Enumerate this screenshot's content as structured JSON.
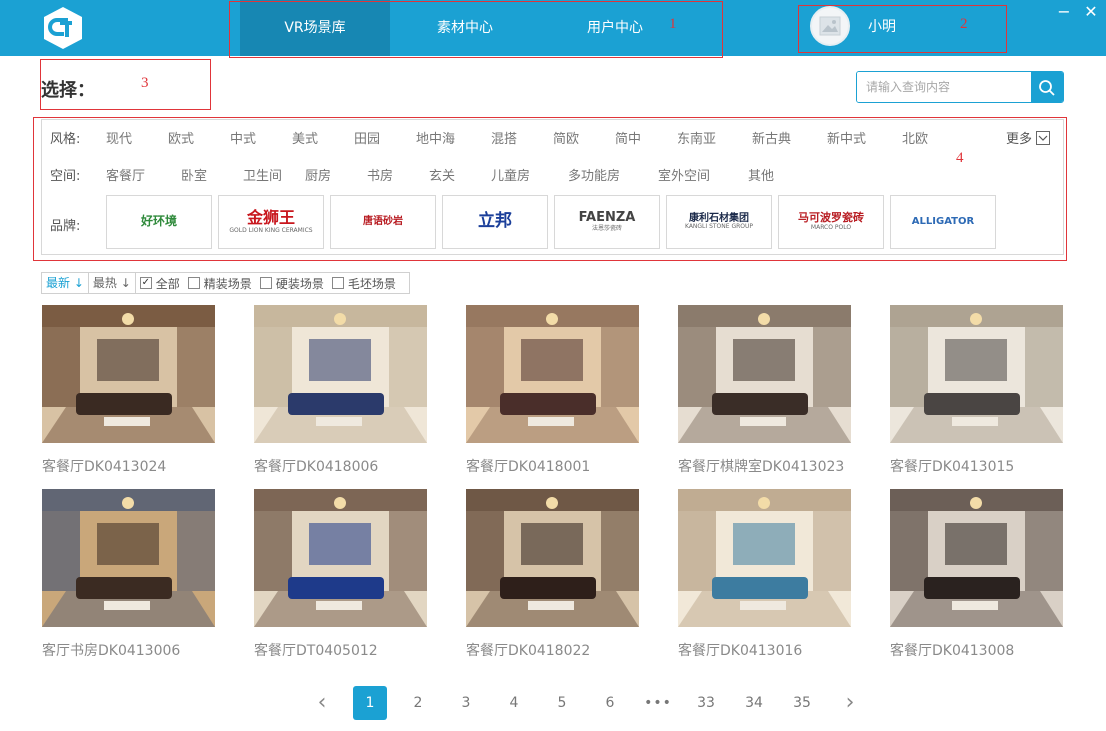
{
  "header": {
    "nav": [
      "VR场景库",
      "素材中心",
      "用户中心"
    ],
    "active_nav": 0,
    "user_name": "小明",
    "window_controls": {
      "minimize": "−",
      "close": "✕"
    }
  },
  "annotations": [
    "1",
    "2",
    "3",
    "4"
  ],
  "select_label": "选择：",
  "search": {
    "placeholder": "请输入查询内容"
  },
  "filters": {
    "style_label": "风格:",
    "styles": [
      "现代",
      "欧式",
      "中式",
      "美式",
      "田园",
      "地中海",
      "混搭",
      "简欧",
      "简中",
      "东南亚",
      "新古典",
      "新中式",
      "北欧"
    ],
    "more_label": "更多",
    "space_label": "空间:",
    "spaces": [
      "客餐厅",
      "卧室",
      "卫生间",
      "厨房",
      "书房",
      "玄关",
      "儿童房",
      "多功能房",
      "室外空间",
      "其他"
    ],
    "brand_label": "品牌:",
    "brands": [
      {
        "main": "好环境",
        "sub": ""
      },
      {
        "main": "金狮王",
        "sub": "GOLD LION KING CERAMICS"
      },
      {
        "main": "唐语砂岩",
        "sub": ""
      },
      {
        "main": "立邦",
        "sub": ""
      },
      {
        "main": "FAENZA",
        "sub": "法恩莎瓷砖"
      },
      {
        "main": "康利石材集团",
        "sub": "KANGLI STONE GROUP"
      },
      {
        "main": "马可波罗瓷砖",
        "sub": "MARCO POLO"
      },
      {
        "main": "ALLIGATOR",
        "sub": ""
      }
    ]
  },
  "sortbar": {
    "newest": "最新",
    "hottest": "最热",
    "checks": [
      {
        "label": "全部",
        "checked": true
      },
      {
        "label": "精装场景",
        "checked": false
      },
      {
        "label": "硬装场景",
        "checked": false
      },
      {
        "label": "毛坯场景",
        "checked": false
      }
    ]
  },
  "scenes": [
    {
      "title": "客餐厅DK0413024",
      "palette": [
        "#6b4a33",
        "#d8c2a4",
        "#3a2a22"
      ]
    },
    {
      "title": "客餐厅DK0418006",
      "palette": [
        "#bfae93",
        "#efe6d7",
        "#2b3a6b"
      ]
    },
    {
      "title": "客餐厅DK0418001",
      "palette": [
        "#8a6a54",
        "#e3c9a8",
        "#4a2e2a"
      ]
    },
    {
      "title": "客餐厅棋牌室DK0413023",
      "palette": [
        "#7a6a5a",
        "#e6ddd1",
        "#3a2d27"
      ]
    },
    {
      "title": "客餐厅DK0413015",
      "palette": [
        "#a39785",
        "#ece6dc",
        "#4a4543"
      ]
    },
    {
      "title": "客厅书房DK0413006",
      "palette": [
        "#4f5a73",
        "#c9a77a",
        "#3b2b22"
      ]
    },
    {
      "title": "客餐厅DT0405012",
      "palette": [
        "#6b5242",
        "#e2d6c2",
        "#1e3a8a"
      ]
    },
    {
      "title": "客餐厅DK0418022",
      "palette": [
        "#5d4535",
        "#d6c3a8",
        "#2e1f1a"
      ]
    },
    {
      "title": "客餐厅DK0413016",
      "palette": [
        "#b7a186",
        "#f1e8d8",
        "#3d7ca0"
      ]
    },
    {
      "title": "客餐厅DK0413008",
      "palette": [
        "#584b43",
        "#d9d0c6",
        "#2a221f"
      ]
    }
  ],
  "pagination": {
    "prev": "‹",
    "pages": [
      "1",
      "2",
      "3",
      "4",
      "5",
      "6",
      "•••",
      "33",
      "34",
      "35"
    ],
    "current": "1",
    "next": "›"
  },
  "colors": {
    "brand": "#1ba1d3",
    "brand_dark": "#1787b3",
    "annotation": "#e0353a"
  }
}
